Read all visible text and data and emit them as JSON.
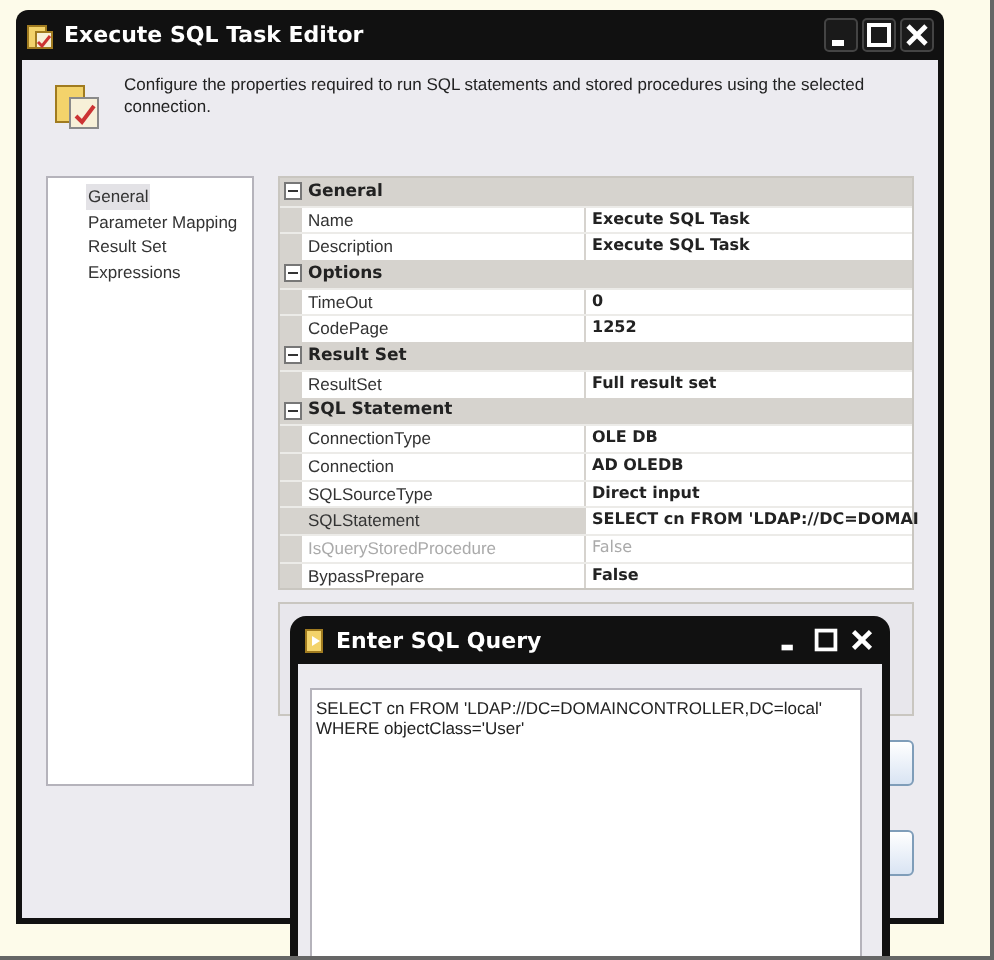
{
  "window": {
    "title": "Execute SQL Task Editor"
  },
  "header": {
    "description": "Configure the properties required to run SQL statements and stored procedures using the selected connection."
  },
  "nav": [
    {
      "label": "General",
      "selected": true
    },
    {
      "label": "Parameter Mapping",
      "selected": false
    },
    {
      "label": "Result Set",
      "selected": false
    },
    {
      "label": "Expressions",
      "selected": false
    }
  ],
  "property_grid": {
    "categories": [
      {
        "name": "General",
        "expanded": true,
        "properties": [
          {
            "name": "Name",
            "value": "Execute SQL Task",
            "selected": false,
            "disabled": false
          },
          {
            "name": "Description",
            "value": "Execute SQL Task",
            "selected": false,
            "disabled": false
          }
        ]
      },
      {
        "name": "Options",
        "expanded": true,
        "properties": [
          {
            "name": "TimeOut",
            "value": "0",
            "selected": false,
            "disabled": false
          },
          {
            "name": "CodePage",
            "value": "1252",
            "selected": false,
            "disabled": false
          }
        ]
      },
      {
        "name": "Result Set",
        "expanded": true,
        "properties": [
          {
            "name": "ResultSet",
            "value": "Full result set",
            "selected": false,
            "disabled": false
          }
        ]
      },
      {
        "name": "SQL Statement",
        "expanded": true,
        "properties": [
          {
            "name": "ConnectionType",
            "value": "OLE DB",
            "selected": false,
            "disabled": false
          },
          {
            "name": "Connection",
            "value": "AD OLEDB",
            "selected": false,
            "disabled": false
          },
          {
            "name": "SQLSourceType",
            "value": "Direct input",
            "selected": false,
            "disabled": false
          },
          {
            "name": "SQLStatement",
            "value": "SELECT cn FROM 'LDAP://DC=DOMAI",
            "selected": true,
            "disabled": false
          },
          {
            "name": "IsQueryStoredProcedure",
            "value": "False",
            "selected": false,
            "disabled": true
          },
          {
            "name": "BypassPrepare",
            "value": "False",
            "selected": false,
            "disabled": false
          }
        ]
      }
    ]
  },
  "dialog": {
    "title": "Enter SQL Query",
    "query": "SELECT cn FROM 'LDAP://DC=DOMAINCONTROLLER,DC=local'\nWHERE objectClass='User'"
  }
}
